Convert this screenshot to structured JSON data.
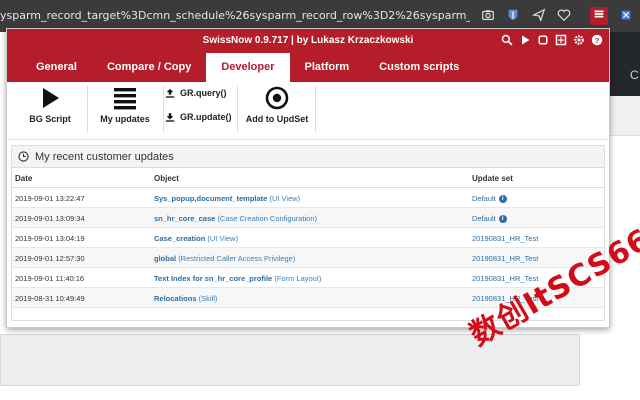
{
  "browser": {
    "url": "ysparm_record_target%3Dcmn_schedule%26sysparm_record_row%3D2%26sysparm_record_rows%3D8"
  },
  "popup": {
    "title": "SwissNow 0.9.717 | by Lukasz Krzaczkowski",
    "tabs": [
      "General",
      "Compare / Copy",
      "Developer",
      "Platform",
      "Custom scripts"
    ],
    "active_tab": "Developer",
    "toolbar": {
      "bg_script": "BG Script",
      "my_updates": "My updates",
      "gr_query": "GR.query()",
      "gr_update": "GR.update()",
      "add_to_updset": "Add to UpdSet"
    },
    "panel_title": "My recent customer updates",
    "columns": {
      "date": "Date",
      "object": "Object",
      "update_set": "Update set"
    },
    "rows": [
      {
        "date": "2019-09-01 13:22:47",
        "name": "Sys_popup,document_template",
        "type": "(UI View)",
        "update_set": "Default",
        "info": true
      },
      {
        "date": "2019-09-01 13:09:34",
        "name": "sn_hr_core_case",
        "type": "(Case Creation Configuration)",
        "update_set": "Default",
        "info": true
      },
      {
        "date": "2019-09-01 13:04:19",
        "name": "Case_creation",
        "type": "(UI View)",
        "update_set": "20190831_HR_Test",
        "info": false
      },
      {
        "date": "2019-09-01 12:57:30",
        "name": "global",
        "type": "(Restricted Caller Access Privilege)",
        "update_set": "20190831_HR_Test",
        "info": false
      },
      {
        "date": "2019-09-01 11:40:16",
        "name": "Text Index for sn_hr_core_profile",
        "type": "(Form Layout)",
        "update_set": "20190831_HR_Test",
        "info": false
      },
      {
        "date": "2019-08-31 10:49:49",
        "name": "Relocations",
        "type": "(Skill)",
        "update_set": "20190831_HR_Test",
        "info": false
      }
    ]
  },
  "watermark": "数创ItSCS66",
  "colors": {
    "brand": "#b51d2b",
    "link": "#2d6ea6"
  }
}
